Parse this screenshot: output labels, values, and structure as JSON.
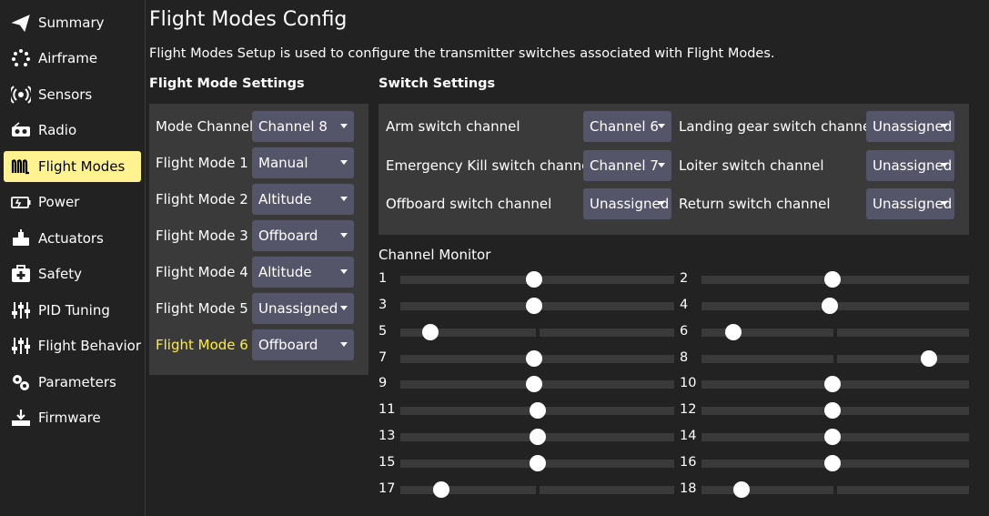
{
  "sidebar": {
    "items": [
      {
        "label": "Summary",
        "icon": "paper-plane-icon",
        "active": false
      },
      {
        "label": "Airframe",
        "icon": "airframe-icon",
        "active": false
      },
      {
        "label": "Sensors",
        "icon": "sensors-icon",
        "active": false
      },
      {
        "label": "Radio",
        "icon": "radio-icon",
        "active": false
      },
      {
        "label": "Flight Modes",
        "icon": "flight-modes-icon",
        "active": true
      },
      {
        "label": "Power",
        "icon": "power-icon",
        "active": false
      },
      {
        "label": "Actuators",
        "icon": "actuators-icon",
        "active": false
      },
      {
        "label": "Safety",
        "icon": "safety-icon",
        "active": false
      },
      {
        "label": "PID Tuning",
        "icon": "pid-tuning-icon",
        "active": false
      },
      {
        "label": "Flight Behavior",
        "icon": "flight-behavior-icon",
        "active": false
      },
      {
        "label": "Parameters",
        "icon": "parameters-icon",
        "active": false
      },
      {
        "label": "Firmware",
        "icon": "firmware-icon",
        "active": false
      }
    ]
  },
  "main": {
    "title": "Flight Modes Config",
    "description": "Flight Modes Setup is used to configure the transmitter switches associated with Flight Modes.",
    "flight_mode_settings": {
      "heading": "Flight Mode Settings",
      "mode_channel": {
        "label": "Mode Channel",
        "value": "Channel 8"
      },
      "modes": [
        {
          "label": "Flight Mode 1",
          "value": "Manual",
          "highlighted": false
        },
        {
          "label": "Flight Mode 2",
          "value": "Altitude",
          "highlighted": false
        },
        {
          "label": "Flight Mode 3",
          "value": "Offboard",
          "highlighted": false
        },
        {
          "label": "Flight Mode 4",
          "value": "Altitude",
          "highlighted": false
        },
        {
          "label": "Flight Mode 5",
          "value": "Unassigned",
          "highlighted": false
        },
        {
          "label": "Flight Mode 6",
          "value": "Offboard",
          "highlighted": true
        }
      ]
    },
    "switch_settings": {
      "heading": "Switch Settings",
      "left": [
        {
          "label": "Arm switch channel",
          "value": "Channel 6"
        },
        {
          "label": "Emergency Kill switch channel",
          "value": "Channel 7"
        },
        {
          "label": "Offboard switch channel",
          "value": "Unassigned"
        }
      ],
      "right": [
        {
          "label": "Landing gear switch channel",
          "value": "Unassigned"
        },
        {
          "label": "Loiter switch channel",
          "value": "Unassigned"
        },
        {
          "label": "Return switch channel",
          "value": "Unassigned"
        }
      ]
    },
    "channel_monitor": {
      "title": "Channel Monitor",
      "channels": [
        {
          "number": "1",
          "position": 0.49
        },
        {
          "number": "2",
          "position": 0.49
        },
        {
          "number": "3",
          "position": 0.49
        },
        {
          "number": "4",
          "position": 0.48
        },
        {
          "number": "5",
          "position": 0.11
        },
        {
          "number": "6",
          "position": 0.12
        },
        {
          "number": "7",
          "position": 0.49
        },
        {
          "number": "8",
          "position": 0.85
        },
        {
          "number": "9",
          "position": 0.49
        },
        {
          "number": "10",
          "position": 0.49
        },
        {
          "number": "11",
          "position": 0.5
        },
        {
          "number": "12",
          "position": 0.49
        },
        {
          "number": "13",
          "position": 0.5
        },
        {
          "number": "14",
          "position": 0.49
        },
        {
          "number": "15",
          "position": 0.5
        },
        {
          "number": "16",
          "position": 0.49
        },
        {
          "number": "17",
          "position": 0.15
        },
        {
          "number": "18",
          "position": 0.15
        }
      ]
    }
  },
  "colors": {
    "background": "#222222",
    "panel": "#3a3a3a",
    "combo": "#55556a",
    "active_nav": "#fff291",
    "highlight_text": "#ffee3b"
  }
}
